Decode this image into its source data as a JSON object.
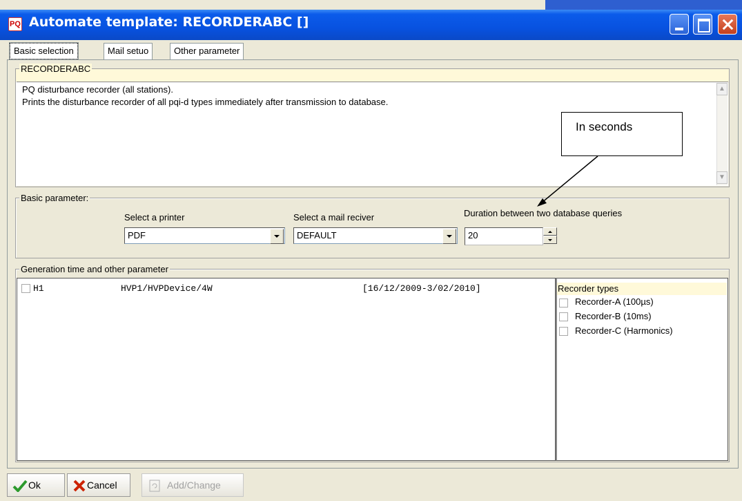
{
  "window": {
    "title": "Automate template: RECORDERABC []"
  },
  "tabs": [
    {
      "label": "Basic selection"
    },
    {
      "label": "Mail setuo"
    },
    {
      "label": "Other parameter"
    }
  ],
  "recorder_group": {
    "legend": "RECORDERABC",
    "description_line1": "PQ disturbance recorder (all stations).",
    "description_line2": "Prints the disturbance recorder of all pqi-d types immediately after transmission to database."
  },
  "basic_parameter": {
    "legend": "Basic parameter:",
    "printer_label": "Select a printer",
    "printer_value": "PDF",
    "mail_label": "Select a mail reciver",
    "mail_value": "DEFAULT",
    "duration_label": "Duration between two database queries",
    "duration_value": "20"
  },
  "generation": {
    "legend": "Generation time and other parameter",
    "rows": [
      {
        "id": "H1",
        "path": "HVP1/HVPDevice/4W",
        "range": "[16/12/2009-3/02/2010]",
        "checked": false
      }
    ],
    "recorder_types_header": "Recorder types",
    "recorder_types": [
      {
        "label": "Recorder-A (100µs)",
        "checked": false
      },
      {
        "label": "Recorder-B (10ms)",
        "checked": false
      },
      {
        "label": "Recorder-C (Harmonics)",
        "checked": false
      }
    ]
  },
  "annotation": {
    "text": "In seconds"
  },
  "buttons": {
    "ok": "Ok",
    "cancel": "Cancel",
    "add_change": "Add/Change"
  },
  "colors": {
    "titlebar": "#0a53e4",
    "highlight": "#fff9d9",
    "ok_check": "#2c9a2c",
    "cancel_x": "#cc2200"
  }
}
